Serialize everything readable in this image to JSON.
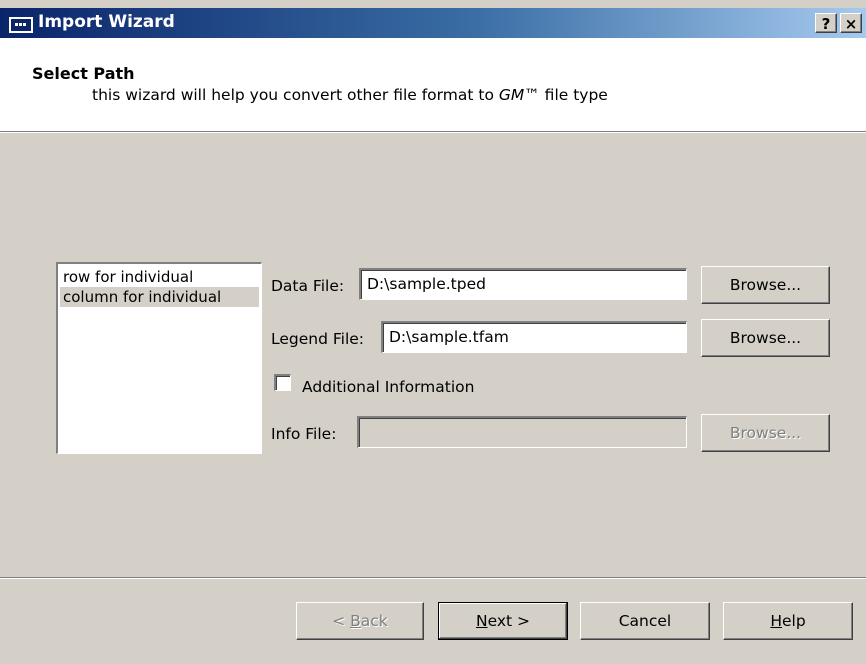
{
  "window": {
    "title": "Import Wizard",
    "help_glyph": "?",
    "close_glyph": "×",
    "icon": "window-menu-icon"
  },
  "header": {
    "title": "Select Path",
    "subtitle_pre": "this wizard will help you convert other file format to ",
    "subtitle_brand": "GM™",
    "subtitle_post": " file type"
  },
  "format_list": {
    "items": [
      "row for individual",
      "column for individual"
    ],
    "selected_index": 1
  },
  "form": {
    "data_file": {
      "label": "Data File:",
      "value": "D:\\sample.tped",
      "browse": "Browse..."
    },
    "legend_file": {
      "label": "Legend File:",
      "value": "D:\\sample.tfam",
      "browse": "Browse..."
    },
    "additional": {
      "label": "Additional Information",
      "checked": false
    },
    "info_file": {
      "label": "Info File:",
      "value": "",
      "browse": "Browse...",
      "enabled": false
    }
  },
  "footer": {
    "back": {
      "pre": "< ",
      "accel": "B",
      "post": "ack",
      "enabled": false
    },
    "next": {
      "accel": "N",
      "post": "ext >"
    },
    "cancel": "Cancel",
    "help": {
      "accel": "H",
      "post": "elp"
    }
  },
  "colors": {
    "dialog_face": "#d4d0c8",
    "titlebar_start": "#0a246a",
    "titlebar_end": "#a6caf0"
  }
}
